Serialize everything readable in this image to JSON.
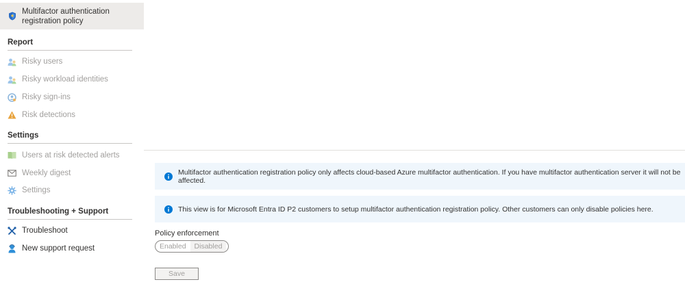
{
  "sidebar": {
    "active_item": {
      "label_line1": "Multifactor authentication",
      "label_line2": "registration policy",
      "icon": "shield-icon"
    },
    "sections": [
      {
        "title": "Report",
        "items": [
          {
            "label": "Risky users",
            "icon": "users-icon",
            "enabled": false
          },
          {
            "label": "Risky workload identities",
            "icon": "workload-identity-icon",
            "enabled": false
          },
          {
            "label": "Risky sign-ins",
            "icon": "sign-in-icon",
            "enabled": false
          },
          {
            "label": "Risk detections",
            "icon": "warning-icon",
            "enabled": false
          }
        ]
      },
      {
        "title": "Settings",
        "items": [
          {
            "label": "Users at risk detected alerts",
            "icon": "alert-book-icon",
            "enabled": false
          },
          {
            "label": "Weekly digest",
            "icon": "mail-icon",
            "enabled": false
          },
          {
            "label": "Settings",
            "icon": "gear-icon",
            "enabled": false
          }
        ]
      },
      {
        "title": "Troubleshooting + Support",
        "items": [
          {
            "label": "Troubleshoot",
            "icon": "tools-icon",
            "enabled": true
          },
          {
            "label": "New support request",
            "icon": "support-person-icon",
            "enabled": true
          }
        ]
      }
    ]
  },
  "main": {
    "info_messages": [
      "Multifactor authentication registration policy only affects cloud-based Azure multifactor authentication. If you have multifactor authentication server it will not be affected.",
      "This view is for Microsoft Entra ID P2 customers to setup multifactor authentication registration policy. Other customers can only disable policies here."
    ],
    "policy_enforcement": {
      "label": "Policy enforcement",
      "options": [
        "Enabled",
        "Disabled"
      ],
      "selected": "Disabled"
    },
    "save_label": "Save"
  },
  "colors": {
    "active_bg": "#edebe9",
    "info_bg": "#eff6fc",
    "info_icon": "#0078d4",
    "disabled_text": "#a19f9d",
    "warning": "#e8a33d"
  }
}
